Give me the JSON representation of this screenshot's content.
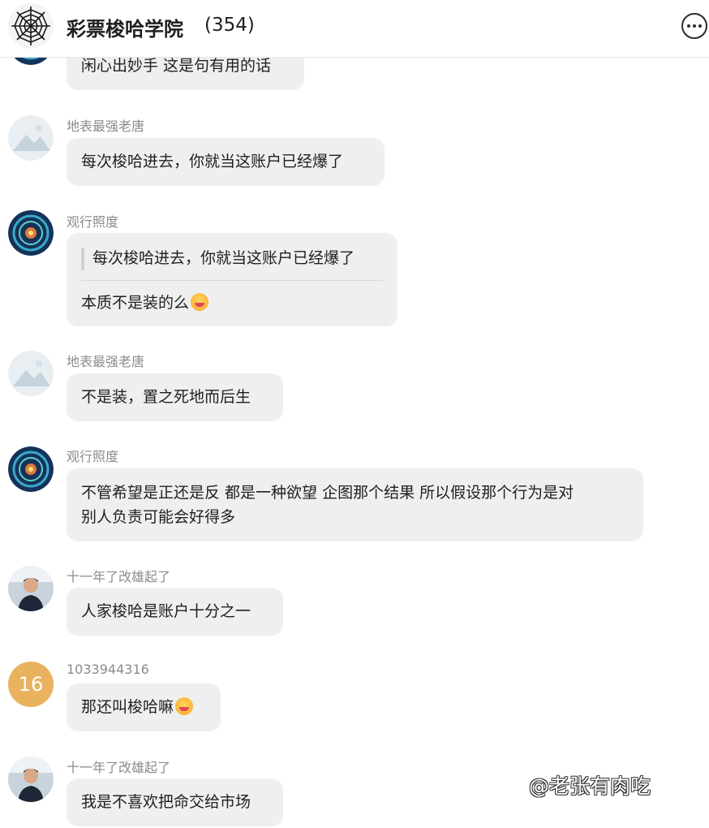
{
  "header": {
    "group_name": "彩票梭哈学院",
    "member_count": "(354)"
  },
  "messages": [
    {
      "text": "闲心出妙手 这是句有用的话"
    },
    {
      "sender": "地表最强老唐",
      "text": "每次梭哈进去，你就当这账户已经爆了"
    },
    {
      "sender": "观行照度",
      "quote": "每次梭哈进去，你就当这账户已经爆了",
      "text": "本质不是装的么"
    },
    {
      "sender": "地表最强老唐",
      "text": "不是装，置之死地而后生"
    },
    {
      "sender": "观行照度",
      "text_line1": "不管希望是正还是反 都是一种欲望 企图那个结果 所以假设那个行为是对",
      "text_line2": "别人负责可能会好得多"
    },
    {
      "sender": "十一年了改雄起了",
      "text": "人家梭哈是账户十分之一"
    },
    {
      "sender": "1033944316",
      "avatar_text": "16",
      "text": "那还叫梭哈嘛"
    },
    {
      "sender": "十一年了改雄起了",
      "text": "我是不喜欢把命交给市场"
    }
  ],
  "watermark": "@老张有肉吃",
  "icons": {
    "group_avatar": "spider-web-icon",
    "more": "more-options-icon",
    "emoji_tongue": "squinting-tongue-emoji",
    "emoji_grin": "grinning-emoji"
  },
  "colors": {
    "bubble": "#efefef",
    "sender_name": "#8b8b8b",
    "number_avatar": "#e9b25f"
  }
}
